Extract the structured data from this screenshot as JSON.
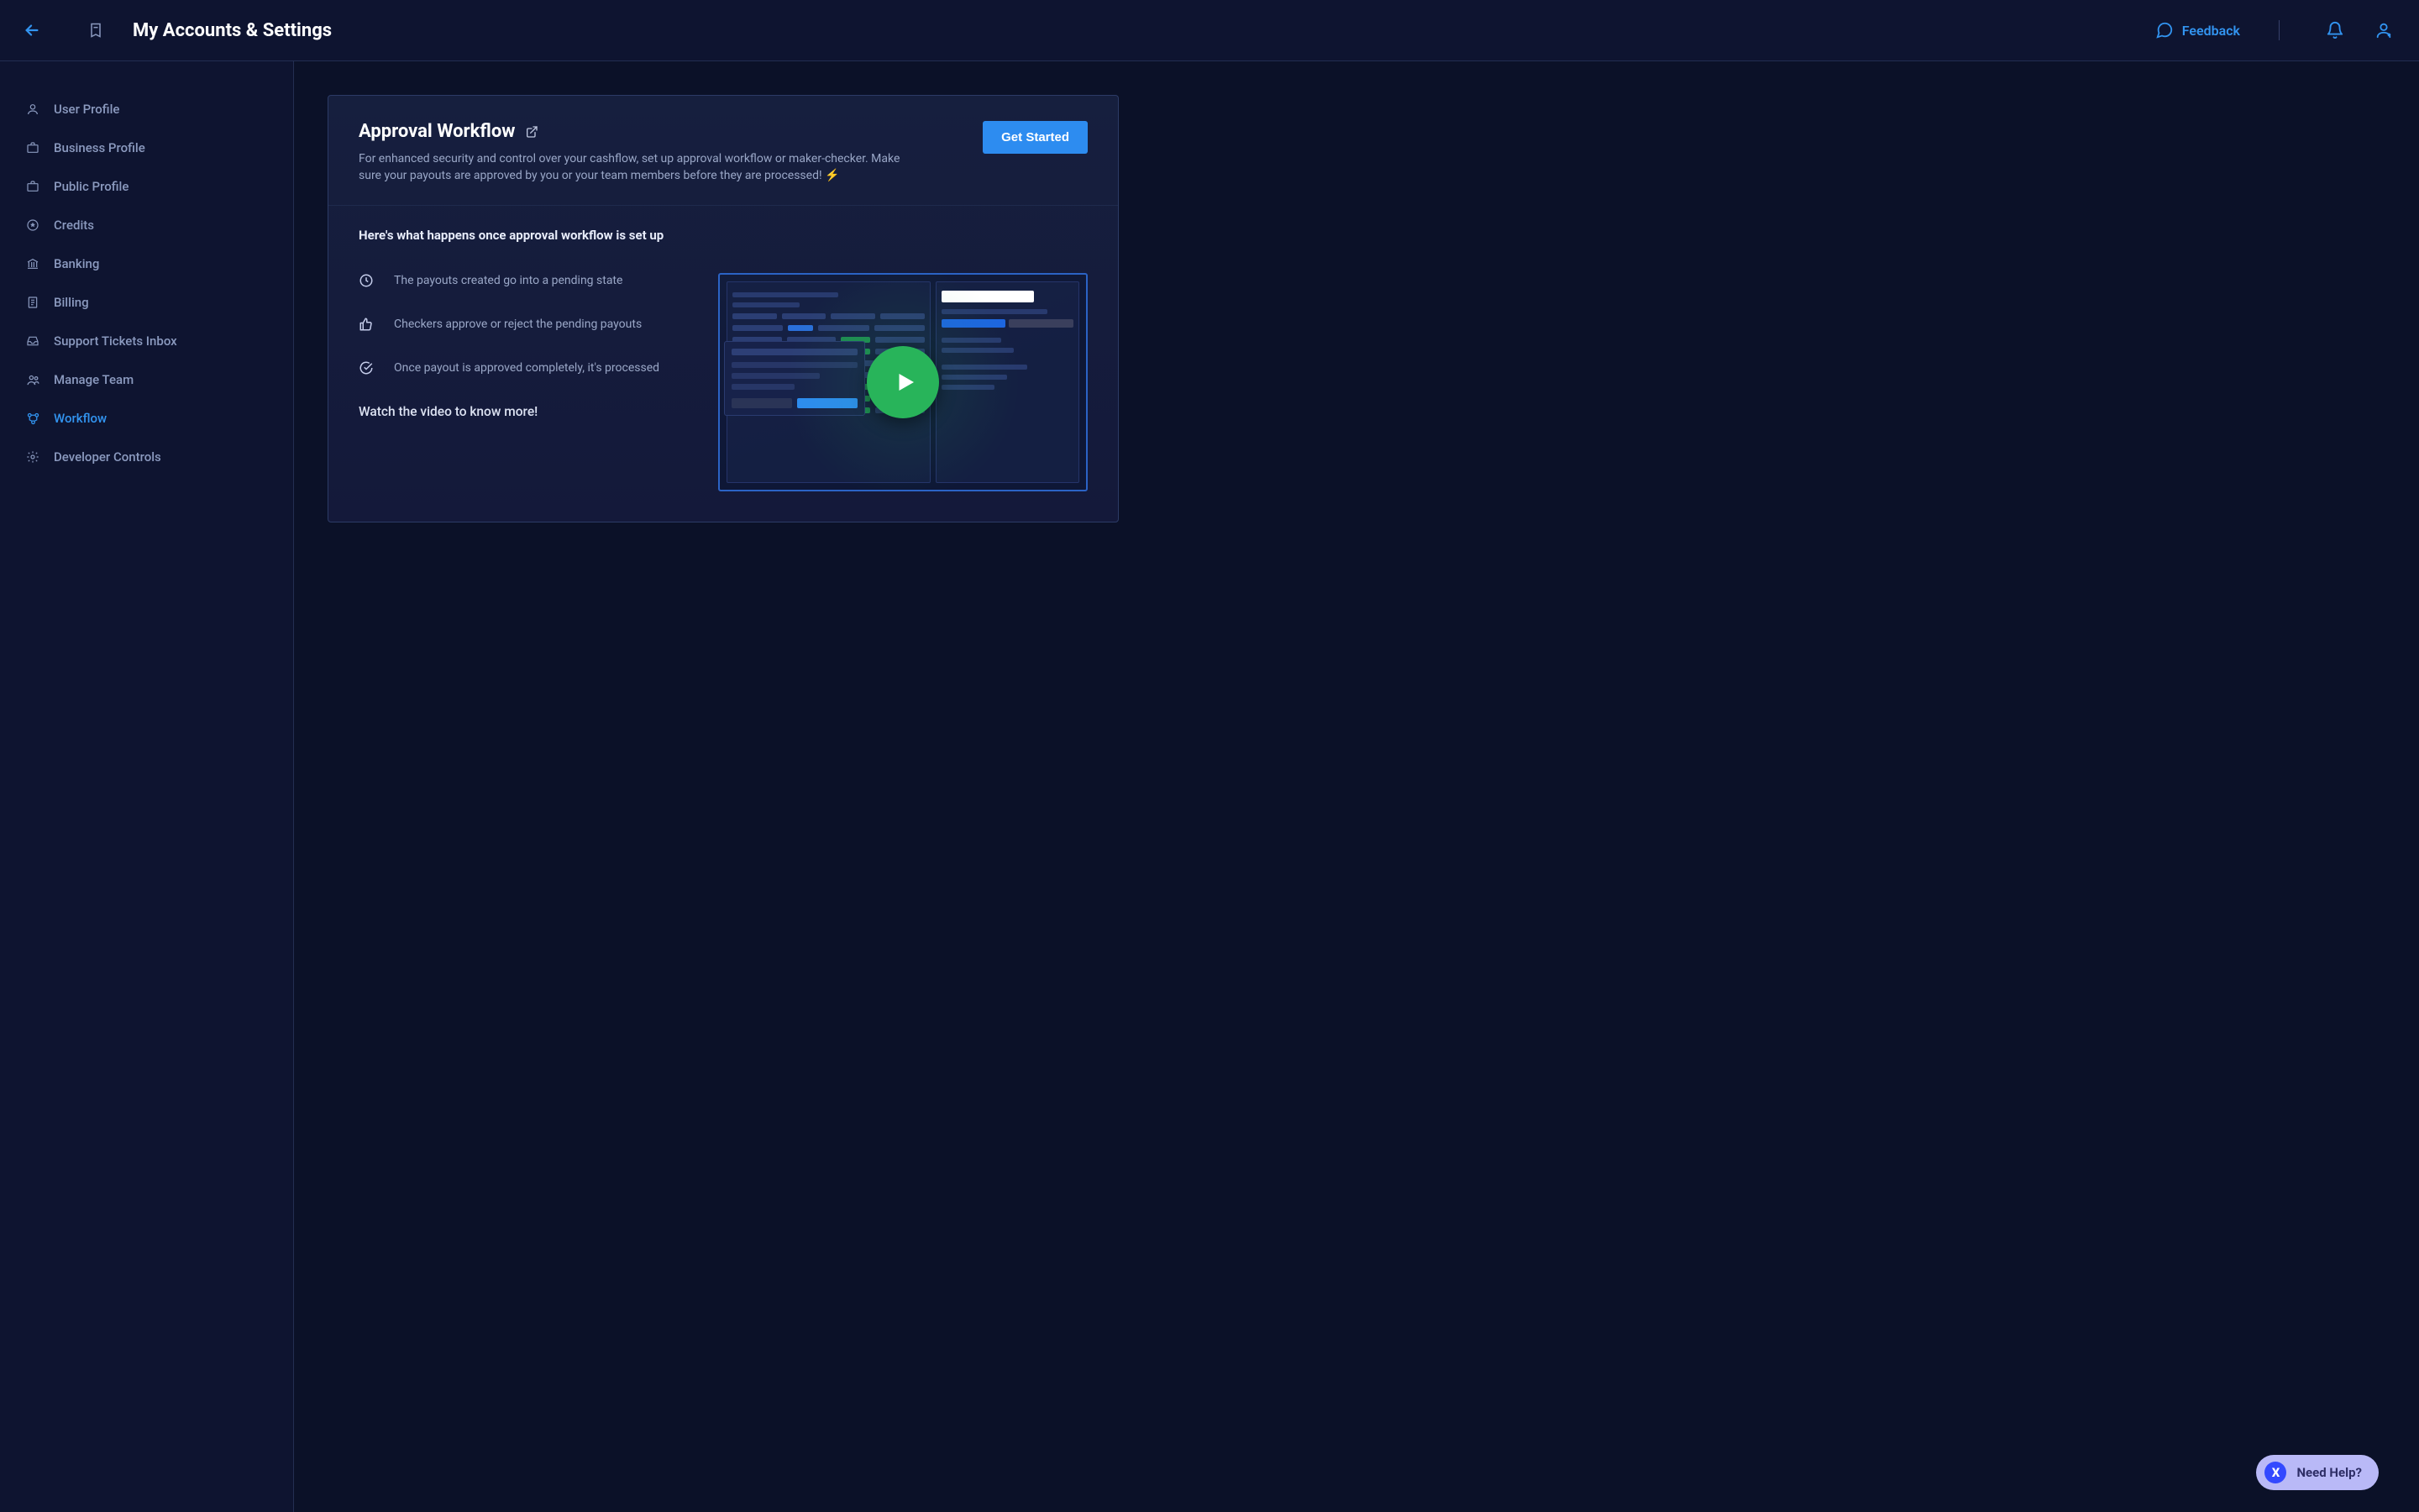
{
  "header": {
    "title": "My Accounts & Settings",
    "feedback_label": "Feedback"
  },
  "sidebar": {
    "items": [
      {
        "label": "User Profile",
        "icon": "person-icon"
      },
      {
        "label": "Business Profile",
        "icon": "briefcase-icon"
      },
      {
        "label": "Public Profile",
        "icon": "briefcase-icon"
      },
      {
        "label": "Credits",
        "icon": "star-circle-icon"
      },
      {
        "label": "Banking",
        "icon": "bank-icon"
      },
      {
        "label": "Billing",
        "icon": "receipt-icon"
      },
      {
        "label": "Support Tickets Inbox",
        "icon": "inbox-icon"
      },
      {
        "label": "Manage Team",
        "icon": "team-icon"
      },
      {
        "label": "Workflow",
        "icon": "workflow-icon",
        "active": true
      },
      {
        "label": "Developer Controls",
        "icon": "gear-icon"
      }
    ]
  },
  "card": {
    "title": "Approval Workflow",
    "description": "For enhanced security and control over your cashflow, set up approval workflow or maker-checker. Make sure your payouts are approved by you or your team members before they are processed! ⚡",
    "cta": "Get Started",
    "section_heading": "Here's what happens once approval workflow is set up",
    "steps": [
      "The payouts created go into a pending state",
      "Checkers approve or reject the pending payouts",
      "Once payout is approved completely, it's processed"
    ],
    "watch_text": "Watch the video to know more!"
  },
  "help": {
    "label": "Need Help?",
    "badge": "X"
  }
}
